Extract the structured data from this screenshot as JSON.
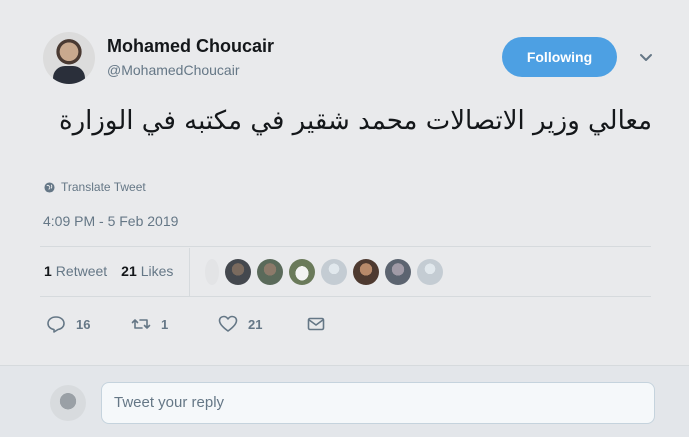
{
  "author": {
    "name": "Mohamed Choucair",
    "handle": "@MohamedChoucair"
  },
  "follow_button": "Following",
  "tweet": {
    "text": "معالي وزير الاتصالات محمد شقير في مكتبه في الوزارة",
    "translate_label": "Translate Tweet",
    "timestamp": "4:09 PM - 5 Feb 2019"
  },
  "stats": {
    "retweets_count": "1",
    "retweets_label": "Retweet",
    "likes_count": "21",
    "likes_label": "Likes"
  },
  "likers_count_shown": 8,
  "actions": {
    "reply_count": "16",
    "retweet_count": "1",
    "like_count": "21"
  },
  "reply_box": {
    "placeholder": "Tweet your reply"
  },
  "colors": {
    "accent": "#4da0e3",
    "background": "#e9eaec",
    "muted_text": "#657786"
  }
}
